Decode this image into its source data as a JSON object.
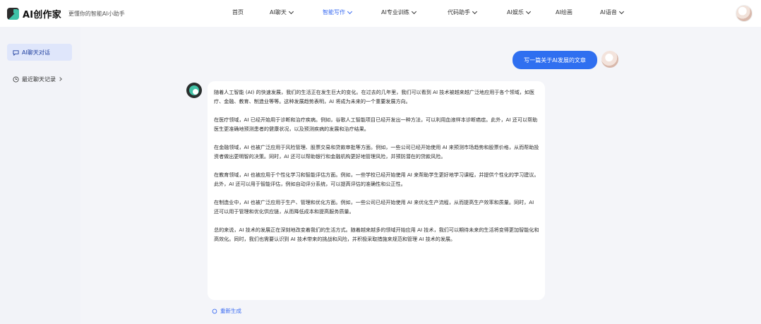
{
  "header": {
    "logo_name": "AI创作家",
    "slogan": "更懂你的智能AI小助手",
    "nav": [
      {
        "label": "首页",
        "dropdown": false,
        "active": false
      },
      {
        "label": "AI聊天",
        "dropdown": true,
        "active": false
      },
      {
        "label": "智能写作",
        "dropdown": true,
        "active": true
      },
      {
        "label": "AI专业训练",
        "dropdown": true,
        "active": false
      },
      {
        "label": "代码助手",
        "dropdown": true,
        "active": false
      },
      {
        "label": "AI娱乐",
        "dropdown": true,
        "active": false
      },
      {
        "label": "AI绘画",
        "dropdown": false,
        "active": false
      },
      {
        "label": "AI语音",
        "dropdown": true,
        "active": false
      }
    ]
  },
  "sidebar": {
    "items": [
      {
        "label": "AI聊天对话",
        "icon": "chat-bubble-icon",
        "active": true
      },
      {
        "label": "最近聊天记录",
        "icon": "clock-icon",
        "active": false
      }
    ]
  },
  "chat": {
    "user_message": "写一篇关于AI发展的文章",
    "bot_paragraphs": [
      "随着人工智能 (AI) 的快速发展，我们的生活正在发生巨大的变化。在过去的几年里，我们可以看到 AI 技术被越来越广泛地应用于各个领域，如医疗、金融、教育、制造业等等。这种发展趋势表明，AI 将成为未来的一个重要发展方向。",
      "在医疗领域，AI 已经开始用于诊断和治疗疾病。例如，谷歌人工智能项目已经开发出一种方法，可以利用血液样本诊断癌症。此外，AI 还可以帮助医生更准确地预测患者的健康状况，以及预测疾病的发展和治疗结果。",
      "在金融领域，AI 也被广泛应用于风险管理、股票交易和贷款审批等方面。例如，一些公司已经开始使用 AI 来预测市场趋势和股票价格，从而帮助投资者做出更明智的决策。同时，AI 还可以帮助银行和金融机构更好地管理风险，并预防潜在的贷款风险。",
      "在教育领域，AI 也被应用于个性化学习和智能评估方面。例如，一些学校已经开始使用 AI 来帮助学生更好地学习课程，并提供个性化的学习建议。此外，AI 还可以用于智能评估，例如自动评分系统，可以提高评估的准确性和公正性。",
      "在制造业中，AI 也被广泛应用于生产、管理和优化方面。例如，一些公司已经开始使用 AI 来优化生产流程，从而提高生产效率和质量。同时，AI 还可以用于管理和优化供应链，从而降低成本和提高服务质量。",
      "总的来说，AI 技术的发展正在深刻地改变着我们的生活方式。随着越来越多的领域开始应用 AI 技术，我们可以期待未来的生活将变得更加智能化和高效化。同时，我们也需要认识到 AI 技术带来的挑战和风险，并积极采取措施来规范和管理 AI 技术的发展。"
    ],
    "regenerate_label": "重新生成"
  },
  "colors": {
    "accent": "#2f6ff0",
    "sidebar_active_bg": "#dfe6fb",
    "page_bg": "#f2f3f8"
  }
}
